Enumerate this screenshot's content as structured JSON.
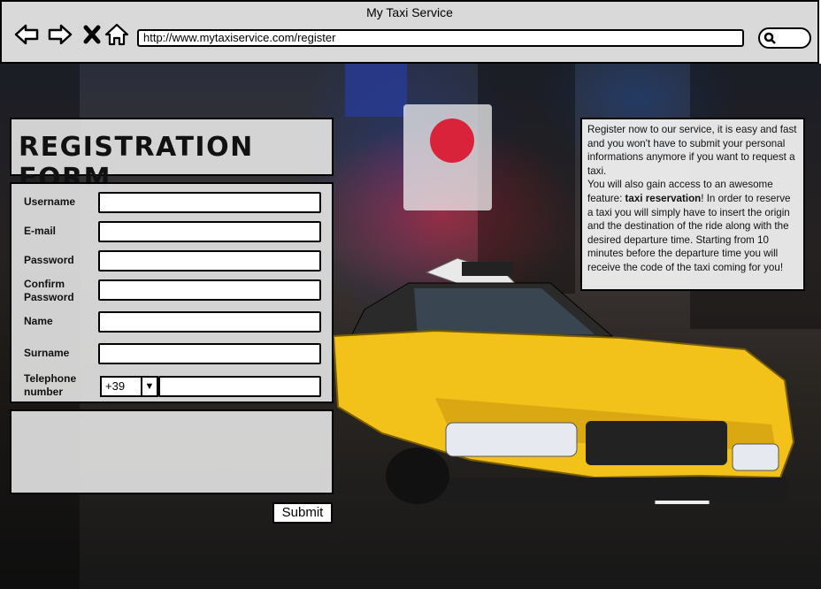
{
  "window": {
    "title": "My Taxi Service"
  },
  "browser": {
    "url": "http://www.mytaxiservice.com/register",
    "icons": [
      "back-arrow-icon",
      "forward-arrow-icon",
      "close-icon",
      "home-icon",
      "search-icon"
    ]
  },
  "form": {
    "title": "REGISTRATION FORM",
    "fields": {
      "username": "Username",
      "email": "E-mail",
      "password": "Password",
      "confirm_password": "Confirm Password",
      "name": "Name",
      "surname": "Surname",
      "telephone": "Telephone number"
    },
    "telephone_prefix": "+39",
    "submit_label": "Submit"
  },
  "info": {
    "p1": "Register now to our service, it is easy and fast and you won't have to submit your personal informations anymore if you want to request a taxi.",
    "p2_before": "You will also gain access to an awesome feature: ",
    "p2_bold": "taxi reservation",
    "p2_after": "! In order to reserve a taxi you will simply have to insert the origin and the destination of the ride along with the desired departure time. Starting from 10 minutes before the departure time you will receive the code of the taxi coming for you!"
  },
  "colors": {
    "taxi_yellow": "#f2c21a",
    "chrome_gray": "#d9d9d9"
  }
}
